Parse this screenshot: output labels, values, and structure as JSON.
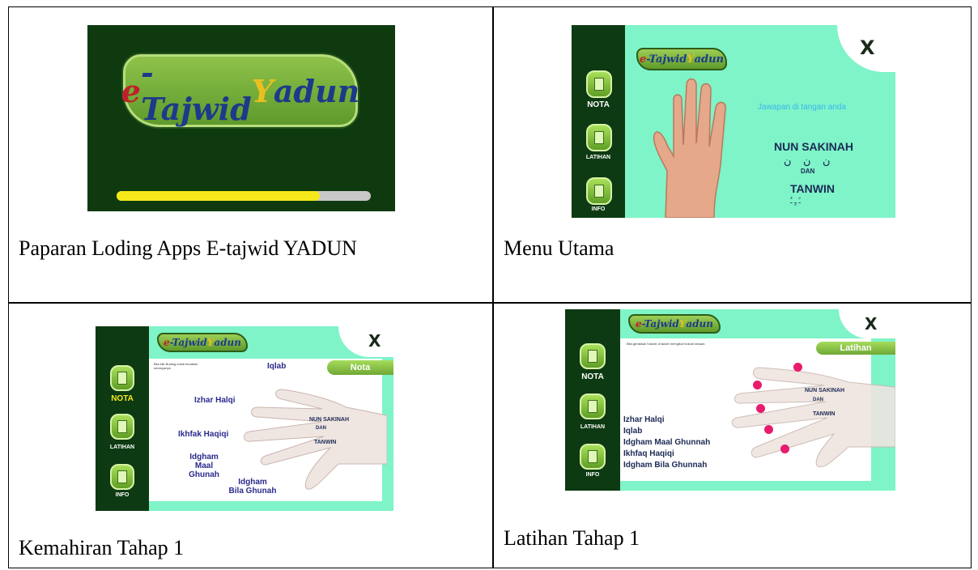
{
  "cells": [
    {
      "caption": "Paparan Loding Apps E-tajwid YADUN"
    },
    {
      "caption": "Menu Utama"
    },
    {
      "caption": "Kemahiran Tahap 1"
    },
    {
      "caption": "Latihan Tahap 1"
    }
  ],
  "app": {
    "logo": {
      "e": "e",
      "tajwid": "-Tajwid ",
      "y": "Y",
      "adun": "adun"
    },
    "close_label": "X",
    "side_labels": {
      "nota": "NOTA",
      "latihan": "LATIHAN",
      "info": "INFO"
    }
  },
  "loading": {
    "progress": 0.8
  },
  "menu": {
    "subtitle": "Jawapan di tangan anda",
    "nun_sakinah": "NUN SAKINAH",
    "dan": "DAN",
    "tanwin": "TANWIN"
  },
  "nota": {
    "tab": "Nota",
    "instruction": "Bila klik Bulang untuk tercakan seranyanya",
    "fingers": [
      "Iqlab",
      "Izhar Halqi",
      "Ikhfak Haqiqi",
      "Idgham\nMaal Ghunah",
      "Idgham\nBila Ghunah"
    ],
    "nun_sakinah": "NUN SAKINAH",
    "dan": "DAN",
    "tanwin": "TANWIN"
  },
  "latihan": {
    "tab": "Latihan",
    "instruction": "Bila gerakkan hukum di tanah mengikut hukum tanuan.",
    "answers": [
      "Izhar Halqi",
      "Iqlab",
      "Idgham Maal Ghunnah",
      "Ikhfaq Haqiqi",
      "Idgham Bila Ghunnah"
    ],
    "nun_sakinah": "NUN SAKINAH",
    "dan": "DAN",
    "tanwin": "TANWIN"
  },
  "colors": {
    "screen_bg": "#7ef4c8",
    "sidebar": "#0d3a12",
    "loading_bg": "#0f3a10",
    "progress": "#f6e81a",
    "marker": "#e81c6c",
    "text_blue": "#2a2a8c"
  }
}
